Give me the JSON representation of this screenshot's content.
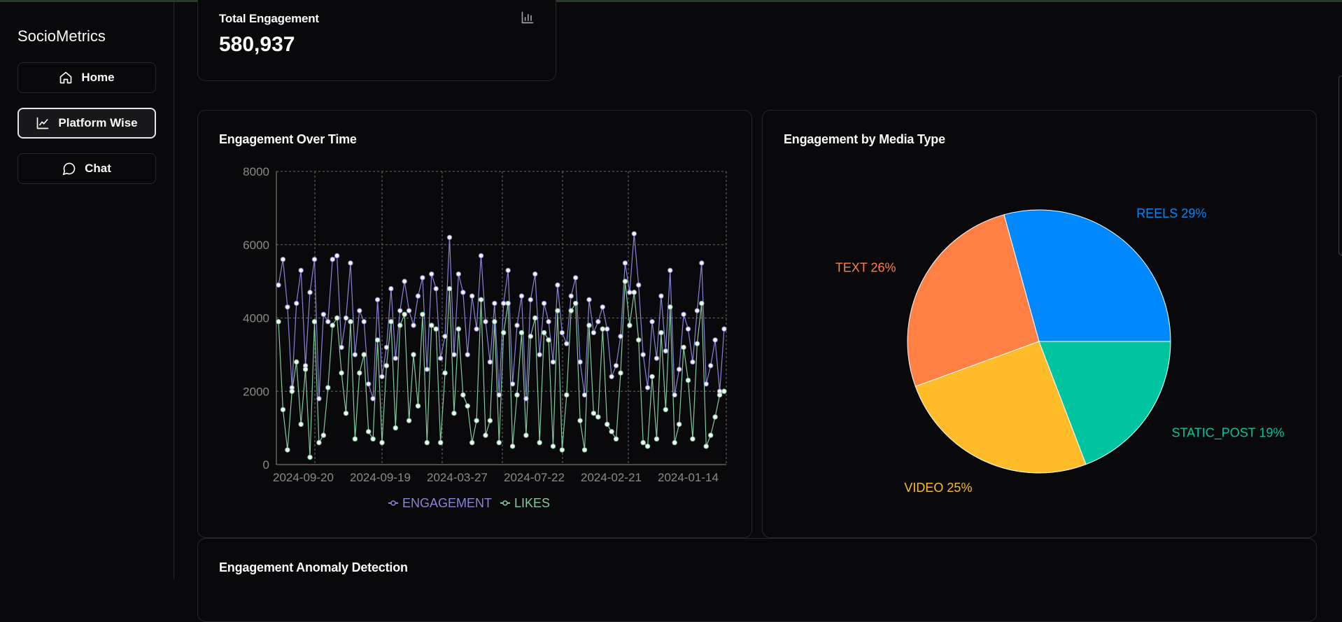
{
  "app": {
    "brand": "SocioMetrics"
  },
  "nav": {
    "home": "Home",
    "platform_wise": "Platform Wise",
    "chat": "Chat"
  },
  "kpi": {
    "label": "Total Engagement",
    "value": "580,937",
    "icon": "bar-chart-icon"
  },
  "line_card": {
    "title": "Engagement Over Time"
  },
  "pie_card": {
    "title": "Engagement by Media Type"
  },
  "anomaly_card": {
    "title": "Engagement Anomaly Detection"
  },
  "colors": {
    "engagement": "#8884d8",
    "likes": "#82ca9d",
    "reels": "#0088fe",
    "static_post": "#00c49f",
    "video": "#ffbb28",
    "text": "#ff8042"
  },
  "chart_data": [
    {
      "type": "line",
      "title": "Engagement Over Time",
      "x_ticks": [
        "2024-09-20",
        "2024-09-19",
        "2024-03-27",
        "2024-07-22",
        "2024-02-21",
        "2024-01-14"
      ],
      "y_ticks": [
        0,
        2000,
        4000,
        6000,
        8000
      ],
      "ylim": [
        0,
        8000
      ],
      "grid": true,
      "legend": "bottom",
      "series": [
        {
          "name": "ENGAGEMENT",
          "values": [
            4900,
            5600,
            4300,
            2100,
            4400,
            5300,
            2700,
            4700,
            5600,
            1800,
            4100,
            3900,
            5600,
            5700,
            3200,
            4000,
            5500,
            3000,
            4200,
            3900,
            2200,
            1800,
            4500,
            2400,
            3200,
            4800,
            2900,
            4200,
            5000,
            4200,
            3800,
            4600,
            5100,
            2600,
            5200,
            4800,
            2900,
            3500,
            6200,
            3000,
            5200,
            4700,
            3000,
            4600,
            3700,
            5700,
            3900,
            2800,
            4400,
            1900,
            4400,
            5300,
            2200,
            3800,
            4600,
            1800,
            4500,
            5200,
            3000,
            4400,
            3900,
            2800,
            4900,
            3600,
            3300,
            4600,
            5100,
            2800,
            1900,
            4500,
            3600,
            3900,
            4300,
            3700,
            2400,
            2700,
            3500,
            5500,
            4700,
            6300,
            4900,
            3000,
            2100,
            3900,
            2900,
            4600,
            3100,
            5300,
            1900,
            2600,
            4100,
            3700,
            2800,
            4200,
            5500,
            2200,
            2700,
            3400,
            2000,
            3700
          ]
        },
        {
          "name": "LIKES",
          "values": [
            3900,
            1500,
            400,
            2000,
            2800,
            1100,
            2600,
            200,
            3900,
            600,
            800,
            2100,
            3800,
            4000,
            2500,
            1400,
            3900,
            700,
            2500,
            3000,
            900,
            700,
            3400,
            600,
            2700,
            3900,
            1000,
            3800,
            4100,
            1200,
            3000,
            1600,
            4100,
            600,
            3800,
            3700,
            600,
            2500,
            4800,
            1400,
            3700,
            1900,
            1600,
            600,
            1200,
            4500,
            800,
            1200,
            3900,
            600,
            3600,
            4400,
            500,
            1900,
            3600,
            800,
            3500,
            4000,
            600,
            3600,
            3400,
            500,
            4200,
            400,
            1900,
            4200,
            4400,
            1200,
            400,
            3800,
            1400,
            1300,
            3700,
            1100,
            900,
            700,
            2500,
            5000,
            3800,
            4700,
            3400,
            600,
            500,
            2400,
            700,
            3600,
            1500,
            4300,
            600,
            1100,
            3200,
            2300,
            700,
            3300,
            4400,
            500,
            800,
            1300,
            1900,
            2000
          ]
        }
      ]
    },
    {
      "type": "pie",
      "title": "Engagement by Media Type",
      "slices": [
        {
          "label": "REELS",
          "value": 29,
          "display": "REELS 29%"
        },
        {
          "label": "TEXT",
          "value": 26,
          "display": "TEXT 26%"
        },
        {
          "label": "VIDEO",
          "value": 25,
          "display": "VIDEO 25%"
        },
        {
          "label": "STATIC_POST",
          "value": 19,
          "display": "STATIC_POST 19%"
        }
      ]
    }
  ]
}
